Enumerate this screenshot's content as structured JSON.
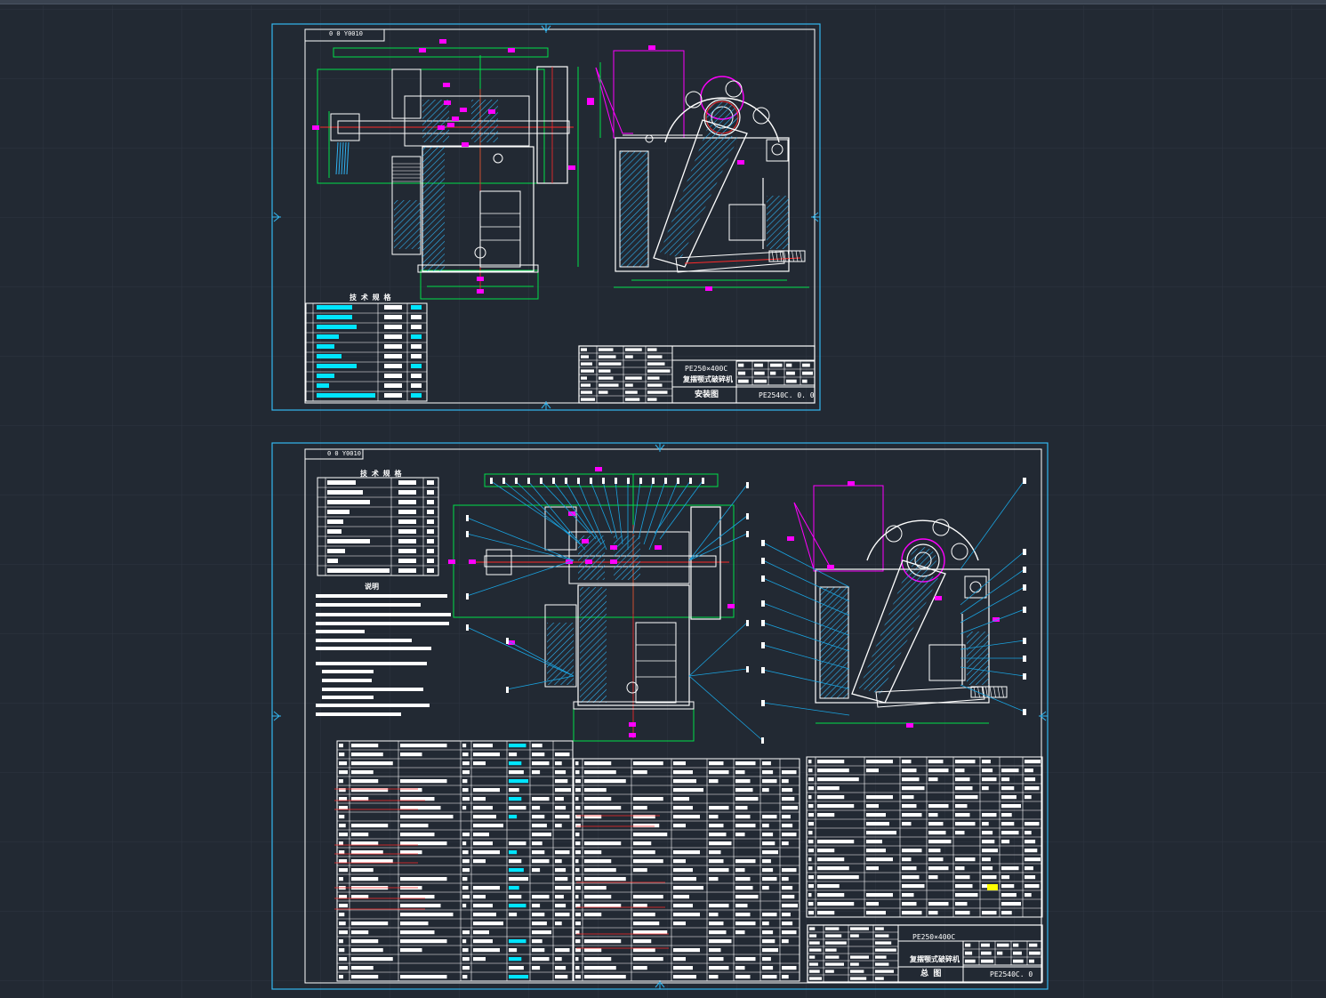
{
  "app": {
    "view": "CAD model space"
  },
  "colors": {
    "background": "#222933",
    "grid": "#2d3541",
    "sheet_border": "#34b7f1",
    "geometry": "#ffffff",
    "dimension": "#00e04a",
    "center_line": "#ff2a2a",
    "hatch": "#2fb2f2",
    "highlight": "#ff00ff",
    "leader": "#1aa3e0",
    "table_fill": "#00e5ff",
    "mark_yellow": "#ffff00"
  },
  "drawing1": {
    "label_box": "0 0 Y0010",
    "tech_table_title": "技 术 规 格",
    "title_block": {
      "model": "PE250×400C",
      "name": "复摆颚式破碎机",
      "sheet": "安装图",
      "code": "PE2540C. 0. 0"
    }
  },
  "drawing2": {
    "label_box": "0 0 Y0010",
    "tech_table_title": "技 术 规 格",
    "notes_title": "说明",
    "title_block": {
      "model": "PE250×400C",
      "name": "复摆颚式破碎机",
      "sheet": "总 图",
      "code": "PE2540C. 0"
    }
  }
}
